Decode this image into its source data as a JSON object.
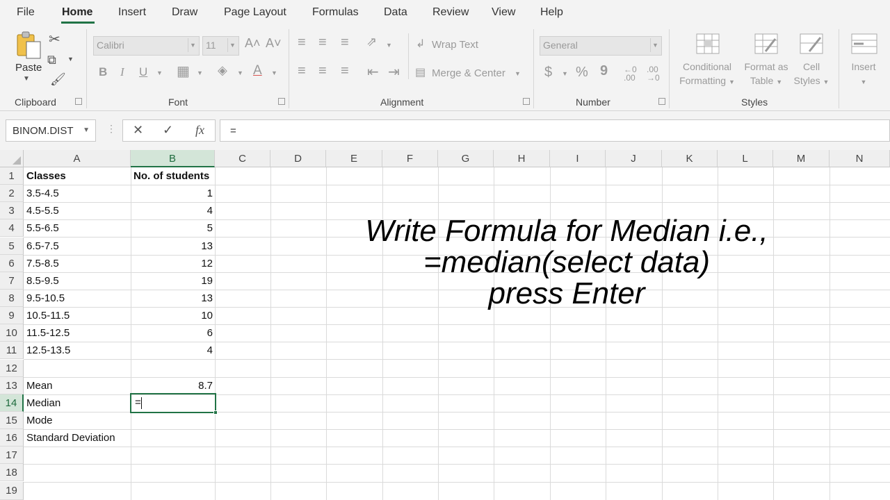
{
  "menu": {
    "tabs": [
      "File",
      "Home",
      "Insert",
      "Draw",
      "Page Layout",
      "Formulas",
      "Data",
      "Review",
      "View",
      "Help"
    ],
    "active": "Home"
  },
  "ribbon": {
    "clipboard": {
      "paste": "Paste",
      "label": "Clipboard"
    },
    "font": {
      "name": "Calibri",
      "size": "11",
      "label": "Font",
      "bold": "B",
      "italic": "I",
      "underline": "U",
      "grow": "A˄",
      "shrink": "A˅",
      "color_a": "A"
    },
    "alignment": {
      "wrap_text": "Wrap Text",
      "merge_center": "Merge & Center",
      "label": "Alignment"
    },
    "number": {
      "format": "General",
      "label": "Number",
      "currency": "$",
      "percent": "%",
      "comma": "9"
    },
    "styles": {
      "conditional": [
        "Conditional",
        "Formatting"
      ],
      "format_table": [
        "Format as",
        "Table"
      ],
      "cell_styles": [
        "Cell",
        "Styles"
      ],
      "label": "Styles"
    },
    "cells": {
      "insert": "Insert"
    }
  },
  "formula_bar": {
    "name_box": "BINOM.DIST",
    "cancel": "✕",
    "enter": "✓",
    "fx": "fx",
    "value": "="
  },
  "columns": [
    "A",
    "B",
    "C",
    "D",
    "E",
    "F",
    "G",
    "H",
    "I",
    "J",
    "K",
    "L",
    "M",
    "N"
  ],
  "selected_column": "B",
  "rows": [
    "1",
    "2",
    "3",
    "4",
    "5",
    "6",
    "7",
    "8",
    "9",
    "10",
    "11",
    "12",
    "13",
    "14",
    "15",
    "16",
    "17",
    "18",
    "19"
  ],
  "selected_row": "14",
  "sheet": {
    "col_a": [
      "Classes",
      "3.5-4.5",
      "4.5-5.5",
      "5.5-6.5",
      "6.5-7.5",
      "7.5-8.5",
      "8.5-9.5",
      "9.5-10.5",
      "10.5-11.5",
      "11.5-12.5",
      "12.5-13.5",
      "",
      "Mean",
      "Median",
      "Mode",
      "Standard Deviation"
    ],
    "col_b": [
      "No. of students",
      "1",
      "4",
      "5",
      "13",
      "12",
      "19",
      "13",
      "10",
      "6",
      "4",
      "",
      "8.7",
      "",
      "",
      ""
    ],
    "active_cell": {
      "ref": "B14",
      "content": "="
    }
  },
  "caption": [
    "Write Formula  for Median i.e.,",
    "=median(select data)",
    "press Enter"
  ],
  "colors": {
    "accent": "#217346",
    "header_bg": "#efefef",
    "ribbon_bg": "#f3f3f3"
  }
}
